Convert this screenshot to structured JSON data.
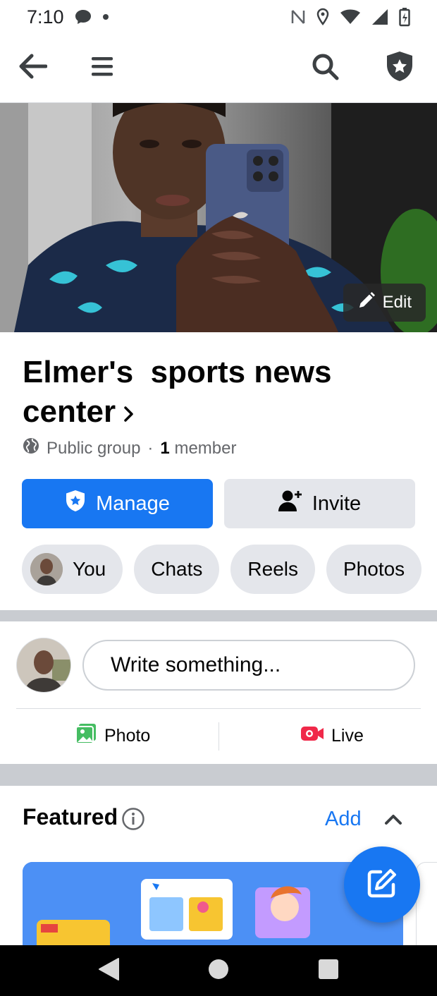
{
  "status_bar": {
    "time": "7:10",
    "icons": [
      "chat-bubble-icon",
      "dot-icon",
      "nfc-icon",
      "location-icon",
      "wifi-icon",
      "signal-icon",
      "battery-charging-icon"
    ]
  },
  "top_nav": {
    "back_icon": "arrow-left-icon",
    "menu_icon": "hamburger-icon",
    "search_icon": "search-icon",
    "admin_icon": "shield-star-icon"
  },
  "cover": {
    "edit_label": "Edit"
  },
  "group": {
    "name": "Elmer's  sports news center",
    "privacy": "Public group",
    "separator": "·",
    "member_count": "1",
    "member_label": "member"
  },
  "actions": {
    "manage_label": "Manage",
    "invite_label": "Invite"
  },
  "chips": [
    {
      "label": "You"
    },
    {
      "label": "Chats"
    },
    {
      "label": "Reels"
    },
    {
      "label": "Photos"
    }
  ],
  "composer": {
    "placeholder": "Write something...",
    "photo_label": "Photo",
    "live_label": "Live"
  },
  "featured": {
    "title": "Featured",
    "add_label": "Add"
  },
  "colors": {
    "brand_blue": "#1877f2",
    "chip_gray": "#e4e6eb",
    "divider_gray": "#c9ccd1",
    "photo_green": "#45bd62",
    "live_red": "#f02849"
  }
}
